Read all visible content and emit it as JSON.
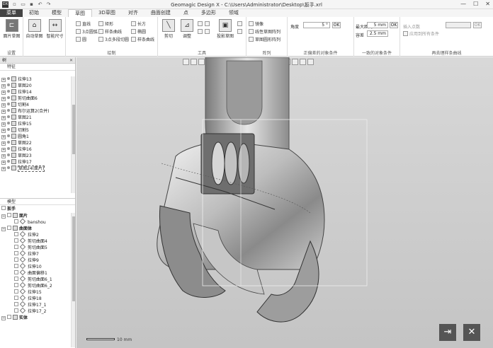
{
  "window": {
    "title": "Geomagic Design X - C:\\Users\\Administrator\\Desktop\\扳手.xrl",
    "min": "—",
    "max": "☐",
    "close": "✕"
  },
  "ribbon_tabs": [
    "菜单",
    "初始",
    "模型",
    "草图",
    "3D草图",
    "对齐",
    "曲面创建",
    "点",
    "多边形",
    "领域"
  ],
  "ribbon": {
    "groups": {
      "settings": "设置",
      "draw": "绘制",
      "tools": "工具",
      "array": "阵列",
      "dev_follow": "正偏差的对象条件",
      "dev_along": "一致的对象条件",
      "region_along": "再去理样条曲线"
    },
    "buttons": {
      "exit_sketch": "面片草图",
      "auto_sketch": "自动草图",
      "mesh_fit": "智能尺寸",
      "line": "直线",
      "rect": "矩形",
      "arc3": "3点圆弧",
      "circle": "圆",
      "polygon": "3点多段切圆",
      "spline": "样条曲线",
      "slot": "长方",
      "ellipse": "椭圆",
      "trim": "剪切",
      "adjust": "调整",
      "face_bridge": "投影草图",
      "mirror": "镜像",
      "linear_array": "线性草图阵列",
      "circ_array": "草图圆形阵列",
      "angle_label": "角度",
      "angle_value": "5 °",
      "ok1": "OK",
      "max_dist_label": "最大距离",
      "max_dist_value": "5 mm",
      "ok2": "OK",
      "tol_label": "容差",
      "tol_value": "2.5 mm",
      "insert_pts_label": "插入点数",
      "insert_pts_value": "",
      "ok3": "OK",
      "apply_all_label": "应用到所有条件"
    }
  },
  "left_panel": {
    "header": "树",
    "pin": "✕",
    "tab_feature": "特征",
    "features": [
      "拉伸13",
      "草图20",
      "拉伸14",
      "剪切曲面6",
      "切割4",
      "布尔运算2(合并)",
      "草图21",
      "拉伸15",
      "切割5",
      "圆角1",
      "草图22",
      "拉伸16",
      "草图23",
      "拉伸17",
      "草图24(面片)"
    ],
    "tab_model": "模型",
    "model_root": "扳手",
    "model_items": [
      {
        "label": "面片",
        "bold": true,
        "level": 0
      },
      {
        "label": "banshou",
        "bold": false,
        "level": 1
      },
      {
        "label": "曲面体",
        "bold": true,
        "level": 0
      },
      {
        "label": "拉伸2",
        "bold": false,
        "level": 1
      },
      {
        "label": "剪切曲面4",
        "bold": false,
        "level": 1
      },
      {
        "label": "剪切曲面5",
        "bold": false,
        "level": 1
      },
      {
        "label": "拉伸7",
        "bold": false,
        "level": 1
      },
      {
        "label": "拉伸9",
        "bold": false,
        "level": 1
      },
      {
        "label": "拉伸10",
        "bold": false,
        "level": 1
      },
      {
        "label": "曲面偏移1",
        "bold": false,
        "level": 1
      },
      {
        "label": "剪切曲面6_1",
        "bold": false,
        "level": 1
      },
      {
        "label": "剪切曲面6_2",
        "bold": false,
        "level": 1
      },
      {
        "label": "拉伸15",
        "bold": false,
        "level": 1
      },
      {
        "label": "拉伸18",
        "bold": false,
        "level": 1
      },
      {
        "label": "拉伸17_1",
        "bold": false,
        "level": 1
      },
      {
        "label": "拉伸17_2",
        "bold": false,
        "level": 1
      },
      {
        "label": "实体",
        "bold": true,
        "level": 0
      }
    ]
  },
  "viewport": {
    "scale_label": "10 mm",
    "exit_icon": "exit-sketch-icon",
    "cancel_icon": "cancel-icon",
    "exit_glyph": "⇥",
    "cancel_glyph": "✕"
  },
  "colors": {
    "accent": "#555555",
    "viewport_bg": "#cfcfcf"
  }
}
